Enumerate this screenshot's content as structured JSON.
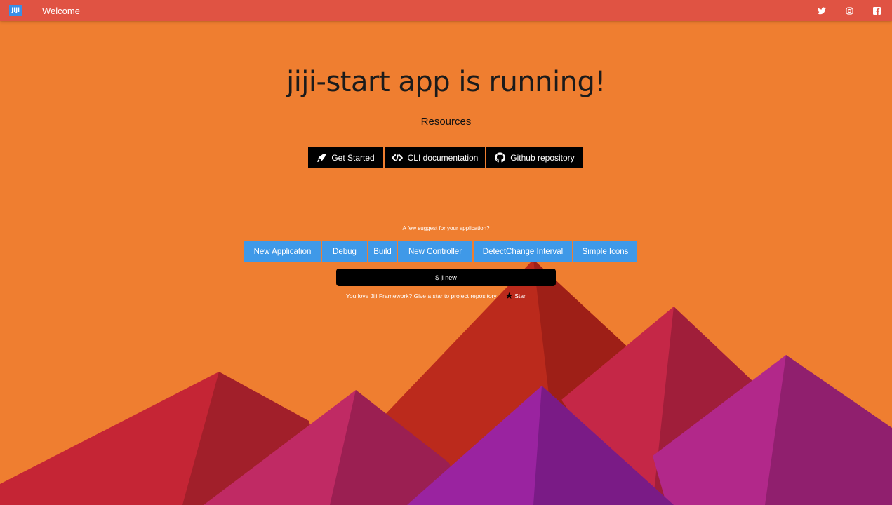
{
  "topbar": {
    "logo_text": "JIJI",
    "title": "Welcome",
    "social": [
      "twitter-icon",
      "instagram-icon",
      "facebook-icon"
    ]
  },
  "main": {
    "title": "jiji-start app is running!",
    "resources_label": "Resources",
    "resources": [
      {
        "label": "Get Started",
        "icon": "rocket-icon"
      },
      {
        "label": "CLI documentation",
        "icon": "code-icon"
      },
      {
        "label": "Github repository",
        "icon": "github-icon"
      }
    ],
    "suggest_label": "A few suggest for your application?",
    "suggestions": [
      "New Application",
      "Debug",
      "Build",
      "New Controller",
      "DetectChange Interval",
      "Simple Icons"
    ],
    "command": "$ ji new",
    "love_text": "You love Jiji Framework? Give a star to project repository",
    "star_label": "Star"
  },
  "colors": {
    "background": "#ef7e30",
    "topbar": "#e05343",
    "chip": "#3f99e8",
    "button": "#000000"
  }
}
